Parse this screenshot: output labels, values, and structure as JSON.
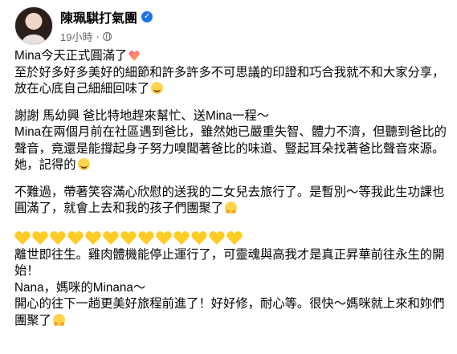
{
  "post": {
    "author": "陳珮騏打氣團",
    "verified": true,
    "time": "19小時",
    "separator": "·",
    "icons": {
      "verified": "verified-badge-icon",
      "audience": "globe-icon",
      "emoji_heart": "sparkling-heart-emoji",
      "emoji_smile": "smiling-face-emoji",
      "emoji_hug": "hugging-face-emoji",
      "yellow_heart": "yellow-heart-emoji"
    },
    "colors": {
      "name": "#050505",
      "secondary": "#65676b",
      "verified_blue": "#1b74e4",
      "yellow_heart": "#ffcc26"
    },
    "paragraphs": {
      "p1_line1": "Mina今天正式圓滿了",
      "p1_line2": "至於好多好多美好的細節和許多許多不可思議的印證和巧合我就不和大家分享，放在心底自己細細回味了",
      "p2_line1": "謝謝 馬幼興 爸比特地趕來幫忙、送Mina一程～",
      "p2_line2": "Mina在兩個月前在社區遇到爸比，雖然她已嚴重失智、體力不濟，但聽到爸比的聲音，竟還是能撐起身子努力嗅聞著爸比的味道、豎起耳朵找著爸比聲音來源。她，記得的",
      "p3": "不難過，帶著笑容滿心欣慰的送我的二女兒去旅行了。是暫別～等我此生功課也圓滿了，就會上去和我的孩子們團聚了",
      "p4_line1": "離世即往生。雞肉體機能停止運行了，可靈魂與高我才是真正昇華前往永生的開始！",
      "p4_line2": "Nana，媽咪的Minana～",
      "p4_line3": "開心的往下一趟更美好旅程前進了！好好修，耐心等。很快～媽咪就上來和妳們團聚了"
    },
    "yellow_heart_count": 13
  }
}
